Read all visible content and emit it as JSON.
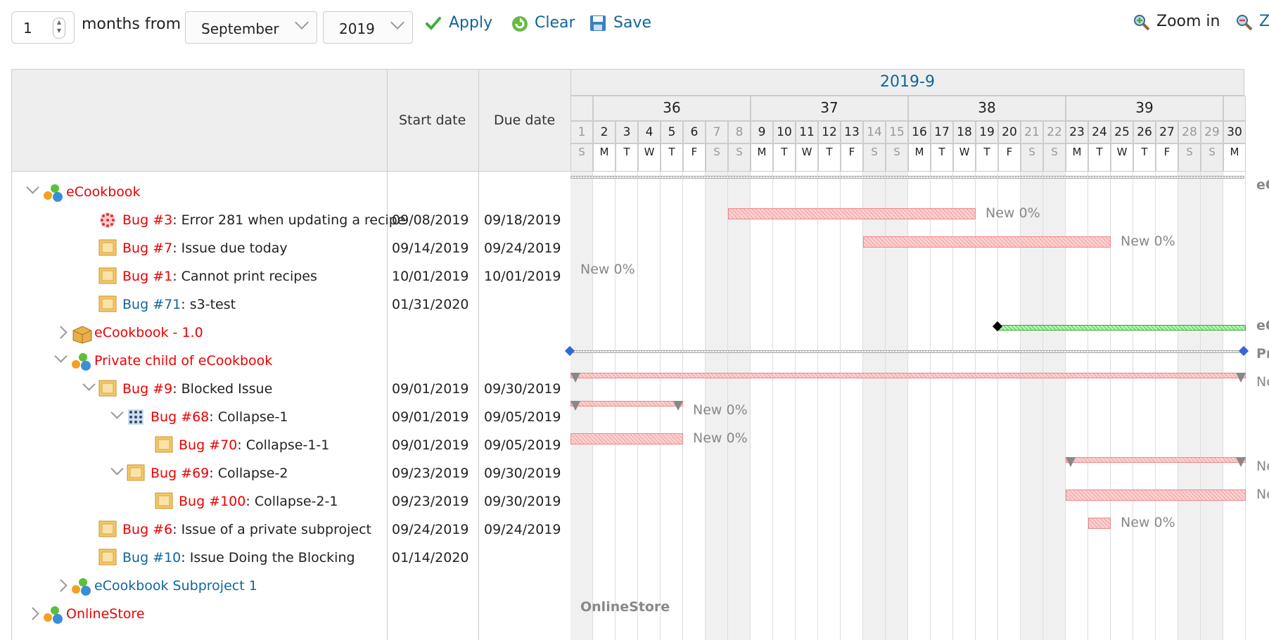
{
  "toolbar": {
    "months_value": "1",
    "months_from_label": "months from",
    "month_selected": "September",
    "year_selected": "2019",
    "apply_label": "Apply",
    "clear_label": "Clear",
    "save_label": "Save",
    "zoom_in_label": "Zoom in",
    "zoom_out_partial": "Z"
  },
  "columns": {
    "start_date": "Start date",
    "due_date": "Due date"
  },
  "gantt_header": {
    "month": "2019-9",
    "weeks": [
      "36",
      "37",
      "38",
      "39"
    ],
    "days": [
      "1",
      "2",
      "3",
      "4",
      "5",
      "6",
      "7",
      "8",
      "9",
      "10",
      "11",
      "12",
      "13",
      "14",
      "15",
      "16",
      "17",
      "18",
      "19",
      "20",
      "21",
      "22",
      "23",
      "24",
      "25",
      "26",
      "27",
      "28",
      "29",
      "30"
    ],
    "weekdays": [
      "S",
      "M",
      "T",
      "W",
      "T",
      "F",
      "S",
      "S",
      "M",
      "T",
      "W",
      "T",
      "F",
      "S",
      "S",
      "M",
      "T",
      "W",
      "T",
      "F",
      "S",
      "S",
      "M",
      "T",
      "W",
      "T",
      "F",
      "S",
      "S",
      "M"
    ]
  },
  "rows": [
    {
      "id": "ecookbook",
      "ref": "eCookbook",
      "ref_color": "red",
      "title": "",
      "start": "",
      "due": "",
      "indent": 0,
      "arrow": "open",
      "icon": "project-icon"
    },
    {
      "id": "bug3",
      "ref": "Bug #3",
      "ref_color": "red",
      "title": ": Error 281 when updating a recipe",
      "start": "09/08/2019",
      "due": "09/18/2019",
      "indent": 2,
      "arrow": "",
      "icon": "bug-dotted-icon",
      "bar_label": "New 0%"
    },
    {
      "id": "bug7",
      "ref": "Bug #7",
      "ref_color": "red",
      "title": ": Issue due today",
      "start": "09/14/2019",
      "due": "09/24/2019",
      "indent": 2,
      "arrow": "",
      "icon": "issue-icon",
      "bar_label": "New 0%"
    },
    {
      "id": "bug1",
      "ref": "Bug #1",
      "ref_color": "red",
      "title": ": Cannot print recipes",
      "start": "10/01/2019",
      "due": "10/01/2019",
      "indent": 2,
      "arrow": "",
      "icon": "issue-icon",
      "bar_label": "New 0%"
    },
    {
      "id": "bug71",
      "ref": "Bug #71",
      "ref_color": "blue",
      "title": ": s3-test",
      "start": "01/31/2020",
      "due": "",
      "indent": 2,
      "arrow": "",
      "icon": "issue-icon"
    },
    {
      "id": "ecookbook10",
      "ref": "eCookbook - 1.0",
      "ref_color": "red",
      "title": "",
      "start": "",
      "due": "",
      "indent": 1,
      "arrow": "closed",
      "icon": "version-icon",
      "bar_label_partial": "eC"
    },
    {
      "id": "privatechild",
      "ref": "Private child of eCookbook",
      "ref_color": "red",
      "title": "",
      "start": "",
      "due": "",
      "indent": 1,
      "arrow": "open",
      "icon": "project-icon",
      "bar_label_partial": "Pr"
    },
    {
      "id": "bug9",
      "ref": "Bug #9",
      "ref_color": "red",
      "title": ": Blocked Issue",
      "start": "09/01/2019",
      "due": "09/30/2019",
      "indent": 2,
      "arrow": "open",
      "icon": "issue-icon",
      "bar_label_partial": "Ne"
    },
    {
      "id": "bug68",
      "ref": "Bug #68",
      "ref_color": "red",
      "title": ": Collapse-1",
      "start": "09/01/2019",
      "due": "09/05/2019",
      "indent": 3,
      "arrow": "open",
      "icon": "bug-grid-icon",
      "bar_label": "New 0%"
    },
    {
      "id": "bug70",
      "ref": "Bug #70",
      "ref_color": "red",
      "title": ": Collapse-1-1",
      "start": "09/01/2019",
      "due": "09/05/2019",
      "indent": 4,
      "arrow": "",
      "icon": "issue-icon",
      "bar_label": "New 0%"
    },
    {
      "id": "bug69",
      "ref": "Bug #69",
      "ref_color": "red",
      "title": ": Collapse-2",
      "start": "09/23/2019",
      "due": "09/30/2019",
      "indent": 3,
      "arrow": "open",
      "icon": "issue-icon",
      "bar_label_partial": "Ne"
    },
    {
      "id": "bug100",
      "ref": "Bug #100",
      "ref_color": "red",
      "title": ": Collapse-2-1",
      "start": "09/23/2019",
      "due": "09/30/2019",
      "indent": 4,
      "arrow": "",
      "icon": "issue-icon",
      "bar_label_partial": "Ne"
    },
    {
      "id": "bug6",
      "ref": "Bug #6",
      "ref_color": "red",
      "title": ": Issue of a private subproject",
      "start": "09/24/2019",
      "due": "09/24/2019",
      "indent": 2,
      "arrow": "",
      "icon": "issue-icon",
      "bar_label": "New 0%"
    },
    {
      "id": "bug10",
      "ref": "Bug #10",
      "ref_color": "blue",
      "title": ": Issue Doing the Blocking",
      "start": "01/14/2020",
      "due": "",
      "indent": 2,
      "arrow": "",
      "icon": "issue-icon"
    },
    {
      "id": "ecookbooksub1",
      "ref": "eCookbook Subproject 1",
      "ref_color": "blue",
      "title": "",
      "start": "",
      "due": "",
      "indent": 1,
      "arrow": "closed",
      "icon": "project-icon"
    },
    {
      "id": "onlinestore",
      "ref": "OnlineStore",
      "ref_color": "red",
      "title": "",
      "start": "",
      "due": "",
      "indent": 0,
      "arrow": "closed",
      "icon": "project-icon",
      "bar_label": "OnlineStore"
    }
  ],
  "colors": {
    "link_red": "#ee0000",
    "link_blue": "#116699",
    "bar_red": "#f7b3b3",
    "bar_green": "#77dd77"
  }
}
